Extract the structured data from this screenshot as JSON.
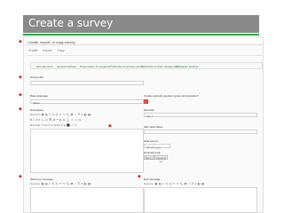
{
  "slide": {
    "title": "Create a survey"
  },
  "form": {
    "heading": "Create, import, or copy survey",
    "nav_tabs": [
      "Create",
      "Import",
      "Copy"
    ],
    "language_tabs": [
      "Text elements",
      "General settings",
      "Presentation & navigation",
      "Publication & access control",
      "Notification & data management",
      "Participant settings"
    ],
    "survey_title": {
      "label": "Survey title:",
      "value": ""
    },
    "base_language": {
      "label": "Base language:",
      "value": "Italian"
    },
    "create_example_label": "Create example question group and question?",
    "description": {
      "label": "Description:"
    },
    "end_url": {
      "label": "End URL:",
      "value": "http://"
    },
    "url_description": {
      "label": "URL description:",
      "value": ""
    },
    "date_format": {
      "label": "Date format:",
      "value": "dd.mm.yyyy"
    },
    "decimal_mark": {
      "label": "Decimal mark:",
      "options": [
        "Dot (.)",
        "Comma (,)"
      ]
    },
    "welcome_message": {
      "label": "Welcome message:"
    },
    "end_message": {
      "label": "End message:"
    },
    "toolbar_source": "Source",
    "toolbar_styles": [
      "Normal",
      "Font",
      "Size"
    ]
  },
  "colors": {
    "title_bar": "#8a8a8a",
    "accent": "#28a745",
    "marker": "#d32f2f",
    "delete": "#e53935"
  }
}
